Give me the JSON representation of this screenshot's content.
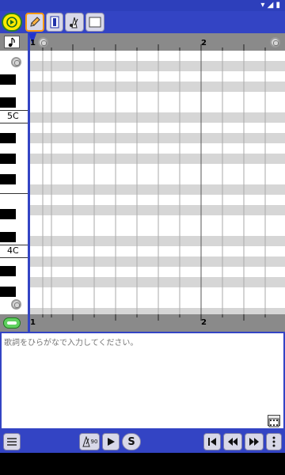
{
  "status": {
    "icons": "▾ ◢ ▮"
  },
  "toolbar": {
    "mode_glyph": "",
    "pencil_icon": "pencil-icon",
    "text_tool_icon": "text-tool-icon",
    "metronome_icon": "metronome-icon",
    "select_icon": "select-rect-icon"
  },
  "editor": {
    "measure_start": "1",
    "measure_next": "2",
    "octave_labels": [
      "5C",
      "4C"
    ],
    "note_length_icon": "eighth-note-icon",
    "lyrics_toggle_icon": "lyrics-toggle-icon"
  },
  "lyrics": {
    "placeholder": "歌詞をひらがなで入力してください。",
    "value": ""
  },
  "bottom": {
    "tempo": "90",
    "solo_label": "S"
  },
  "colors": {
    "accent": "#3344c4",
    "active_outline": "#ff9a10",
    "grid_light": "#ffffff",
    "grid_dark": "#d6d6d6"
  }
}
